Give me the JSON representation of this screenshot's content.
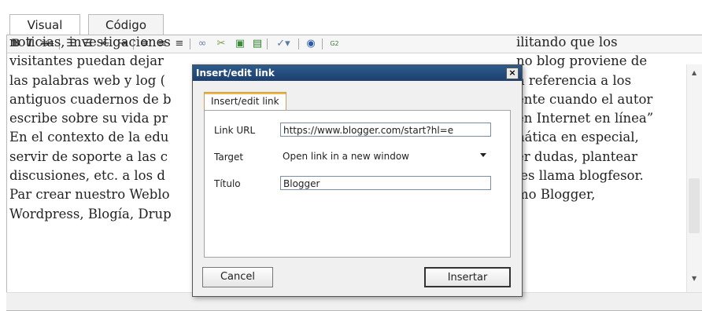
{
  "tabs": [
    {
      "label": "Visual",
      "active": true
    },
    {
      "label": "Código",
      "active": false
    }
  ],
  "toolbar": {
    "bold": "B",
    "italic": "I",
    "strike": "ABC",
    "items": [
      "unordered-list",
      "ordered-list",
      "outdent",
      "indent",
      "align-left",
      "align-center",
      "align-right",
      "link",
      "unlink",
      "insert-image",
      "page-break",
      "spellcheck",
      "help",
      "g2"
    ]
  },
  "content_lines": [
    "noticias, investigaciones",
    "visitantes puedan dejar",
    "las palabras web y log (",
    "antiguos cuadernos de b",
    "escribe sobre su vida pr",
    "En el contexto de la edu",
    "servir de soporte a las c",
    "discusiones, etc.  a los d",
    "Par crear nuestro Weblo",
    "Wordpress, Blogía, Drup"
  ],
  "content_right": [
    "ilitando que los",
    "no blog proviene de",
    "n referencia a los",
    "ente cuando el autor",
    "en Internet en línea”",
    "nática en especial,",
    "er dudas, plantear",
    "les llama blogfesor.",
    "mo Blogger,",
    ""
  ],
  "dialog": {
    "title": "Insert/edit link",
    "close": "×",
    "tab_label": "Insert/edit link",
    "link_url_label": "Link URL",
    "link_url_value": "https://www.blogger.com/start?hl=e",
    "target_label": "Target",
    "target_value": "Open link in a new window",
    "title_label": "Título",
    "title_value": "Blogger",
    "cancel": "Cancel",
    "insert": "Insertar"
  }
}
